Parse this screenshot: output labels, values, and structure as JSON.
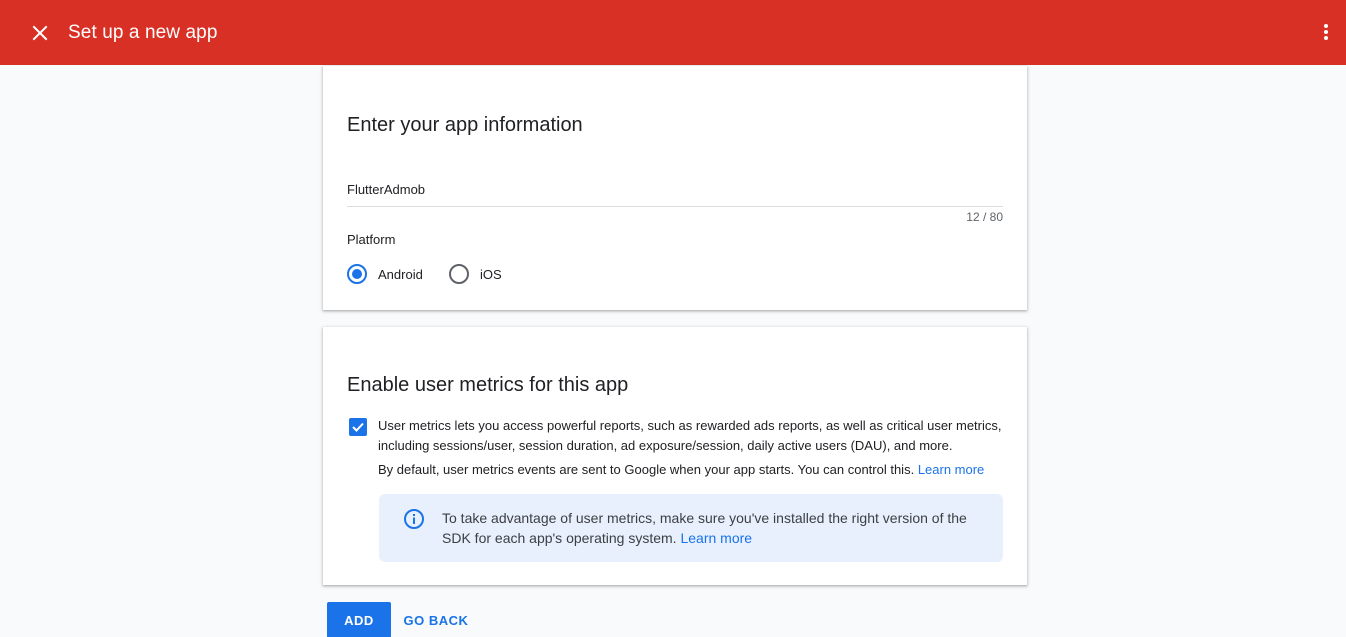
{
  "header": {
    "title": "Set up a new app",
    "close_icon": "close-icon",
    "more_icon": "more-vert-icon",
    "color": "#d93025"
  },
  "app_info": {
    "title": "Enter your app information",
    "app_name_value": "FlutterAdmob",
    "char_count": "12 / 80",
    "platform_label": "Platform",
    "platforms": [
      {
        "label": "Android",
        "selected": true
      },
      {
        "label": "iOS",
        "selected": false
      }
    ]
  },
  "metrics": {
    "title": "Enable user metrics for this app",
    "checked": true,
    "description": "User metrics lets you access powerful reports, such as rewarded ads reports, as well as critical user metrics, including sessions/user, session duration, ad exposure/session, daily active users (DAU), and more.",
    "default_text": "By default, user metrics events are sent to Google when your app starts. You can control this.",
    "default_link": "Learn more",
    "info_text": "To take advantage of user metrics, make sure you've installed the right version of the SDK for each app's operating system.",
    "info_link": "Learn more"
  },
  "actions": {
    "add_label": "ADD",
    "back_label": "GO BACK"
  },
  "colors": {
    "accent": "#1a73e8",
    "info_bg": "#e8f0fe"
  }
}
